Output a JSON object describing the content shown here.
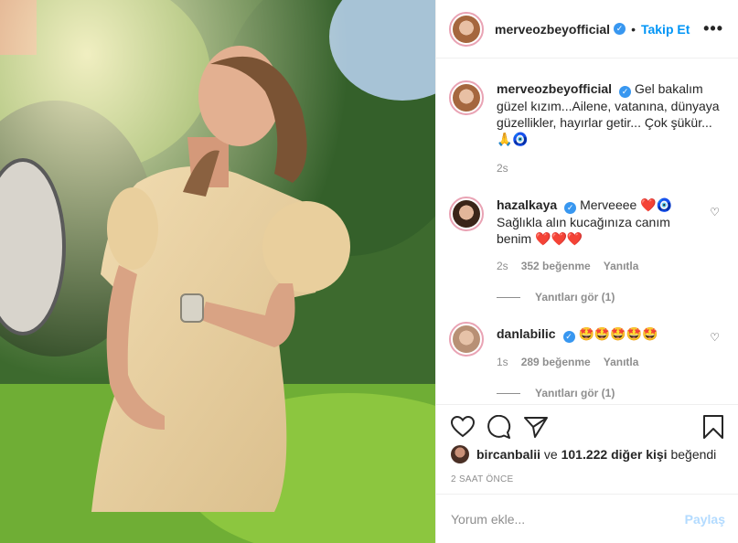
{
  "post": {
    "author": "merveozbeyofficial",
    "follow_label": "Takip Et",
    "more_label": "•••",
    "caption": "Gel bakalım güzel kızım...Ailene, vatanına, dünyaya güzellikler, hayırlar getir... Çok şükür...",
    "caption_emoji": "🙏🧿",
    "caption_time": "2s"
  },
  "comments": [
    {
      "user": "hazalkaya",
      "text": "Merveeee ❤️🧿 Sağlıkla alın kucağınıza canım benim ❤️❤️❤️",
      "time": "2s",
      "likes": "352 beğenme",
      "reply": "Yanıtla",
      "view_replies": "Yanıtları gör (1)"
    },
    {
      "user": "danlabilic",
      "text": "🤩🤩🤩🤩🤩",
      "time": "1s",
      "likes": "289 beğenme",
      "reply": "Yanıtla",
      "view_replies": "Yanıtları gör (1)"
    }
  ],
  "likes_bar": {
    "liker": "bircanbalii",
    "connector": "ve",
    "others": "101.222 diğer kişi",
    "suffix": "beğendi"
  },
  "time_ago": "2 SAAT ÖNCE",
  "add_comment": {
    "placeholder": "Yorum ekle...",
    "post_label": "Paylaş"
  },
  "icons": [
    "heart-icon",
    "comment-icon",
    "share-icon",
    "bookmark-icon",
    "more-icon",
    "verified-icon"
  ],
  "colors": {
    "accent": "#0095f6",
    "verified": "#3897f0",
    "muted": "#8e8e8e",
    "post_disabled": "#b3dbff"
  }
}
